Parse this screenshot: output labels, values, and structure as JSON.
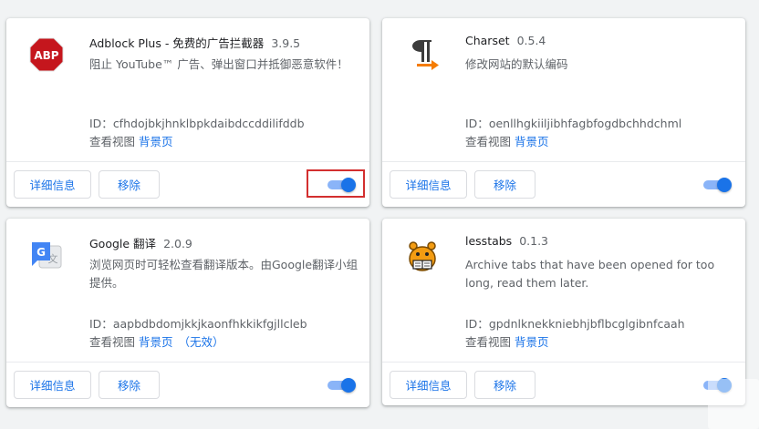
{
  "colors": {
    "accent": "#1a73e8",
    "toggle_track": "#8ab4f8",
    "highlight_box": "#d32f2f",
    "abp_red": "#c5161d"
  },
  "buttons": {
    "details": "详细信息",
    "remove": "移除"
  },
  "labels": {
    "id_prefix": "ID：",
    "inspect_views": "查看视图",
    "background_page": "背景页",
    "inactive": "（无效）"
  },
  "extensions": [
    {
      "name": "Adblock Plus - 免费的广告拦截器",
      "version": "3.9.5",
      "description": "阻止 YouTube™ 广告、弹出窗口并抵御恶意软件！",
      "id": "cfhdojbkjhnklbpkdaibdccddilifddb",
      "icon": "abp-icon",
      "icon_text": "ABP",
      "enabled": true
    },
    {
      "name": "Charset",
      "version": "0.5.4",
      "description": "修改网站的默认编码",
      "id": "oenllhgkiiljibhfagbfogdbchhdchml",
      "icon": "pilcrow-icon",
      "enabled": true
    },
    {
      "name": "Google 翻译",
      "version": "2.0.9",
      "description": "浏览网页时可轻松查看翻译版本。由Google翻译小组提供。",
      "id": "aapbdbdomjkkjkaonfhkkikfgjllcleb",
      "icon": "google-translate-icon",
      "icon_text": "G",
      "enabled": true
    },
    {
      "name": "lesstabs",
      "version": "0.1.3",
      "description": "Archive tabs that have been opened for too long, read them later.",
      "id": "gpdnlknekkniebhjbflbcglgibnfcaah",
      "icon": "beaver-icon",
      "enabled": true
    }
  ]
}
